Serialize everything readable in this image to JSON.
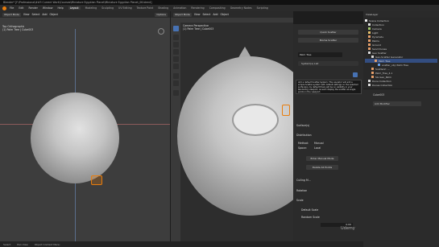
{
  "window": {
    "title": "Blender* [F:\\Professional\\##3 Current Work\\Courses\\Miniature Egyptian Planet\\Miniature Egyptian Planet_06.blend]"
  },
  "menu": [
    "File",
    "Edit",
    "Render",
    "Window",
    "Help"
  ],
  "workspaces": [
    "Layout",
    "Modeling",
    "Sculpting",
    "UV Editing",
    "Texture Paint",
    "Shading",
    "Animation",
    "Rendering",
    "Compositing",
    "Geometry Nodes",
    "Scripting"
  ],
  "active_workspace": "Layout",
  "left_viewport": {
    "mode": "Object Mode",
    "menus": [
      "View",
      "Select",
      "Add",
      "Object"
    ],
    "title": "Top Orthographic",
    "subtitle": "(1) Palm Tree | Cube003",
    "options": "Options"
  },
  "main_viewport": {
    "mode": "Object Mode",
    "menus": [
      "View",
      "Select",
      "Add",
      "Object"
    ],
    "title": "Camera Perspective",
    "subtitle": "(1) Palm Tree | Cube003",
    "options": "Options"
  },
  "scatter_panel": {
    "quick_scatter": "Quick Scatter",
    "biome_scatter": "Biome Scatter",
    "system_list": "System(s) List",
    "system_name": "Palm Tree",
    "tooltip": "Add a default Scatter-System. This operator will add a simple Scatter-system with default settings on the selected surface(s), by default there will be no visibility in your Rendering viewport, as we'll display the scatter as single points in the viewport.",
    "sections": [
      "Surface(s)",
      "Distribution",
      "Culling M...",
      "Rotation",
      "Scale"
    ],
    "method_label": "Method:",
    "method_value": "Manual",
    "space_label": "Space:",
    "space_value": "Local",
    "enter_manual_mode": "Enter Manual Mode",
    "delete_all_points": "Delete All Points",
    "default_scale": "Default Scale",
    "random_scale": "Random Scale",
    "factor": "0.00"
  },
  "outliner": {
    "title": "Scene Collection",
    "view_layer": "ViewLayer",
    "items": [
      "Collection",
      "Camera",
      "Light",
      "Pyramids",
      "Palms",
      "Ground",
      "Sand Dunes",
      "Geo Scatter",
      "Geo-Scatter Generator",
      "Palm Tree",
      "scatter_obj: Palm Tree",
      "Scatter2: ...",
      "Palm_Tree_4.1",
      "SG Geo_Palm",
      "Dune Collection",
      "Dunes Collection"
    ]
  },
  "properties": {
    "add_modifier": "Add Modifier",
    "object_name": "Cube003"
  },
  "status": {
    "select": "Select",
    "pan": "Pan View",
    "context": "Object Context Menu",
    "version": "3.6.1"
  },
  "watermark": "Udemy",
  "colors": {
    "accent": "#4772b3",
    "panel": "#2b2b2b",
    "viewport": "#3d3d3d"
  }
}
